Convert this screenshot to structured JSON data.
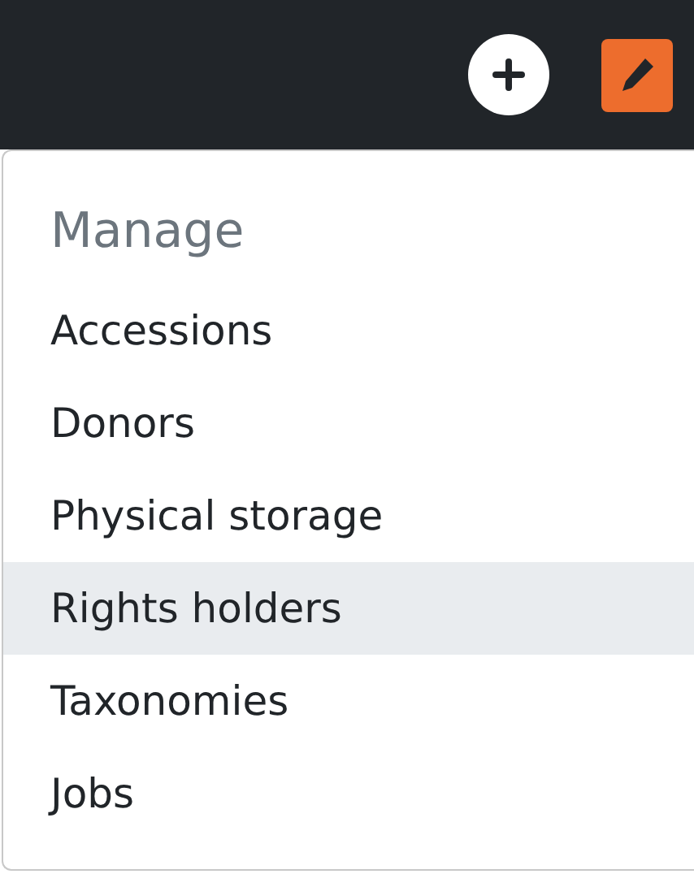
{
  "menu": {
    "header": "Manage",
    "items": [
      {
        "label": "Accessions",
        "selected": false
      },
      {
        "label": "Donors",
        "selected": false
      },
      {
        "label": "Physical storage",
        "selected": false
      },
      {
        "label": "Rights holders",
        "selected": true
      },
      {
        "label": "Taxonomies",
        "selected": false
      },
      {
        "label": "Jobs",
        "selected": false
      }
    ]
  }
}
